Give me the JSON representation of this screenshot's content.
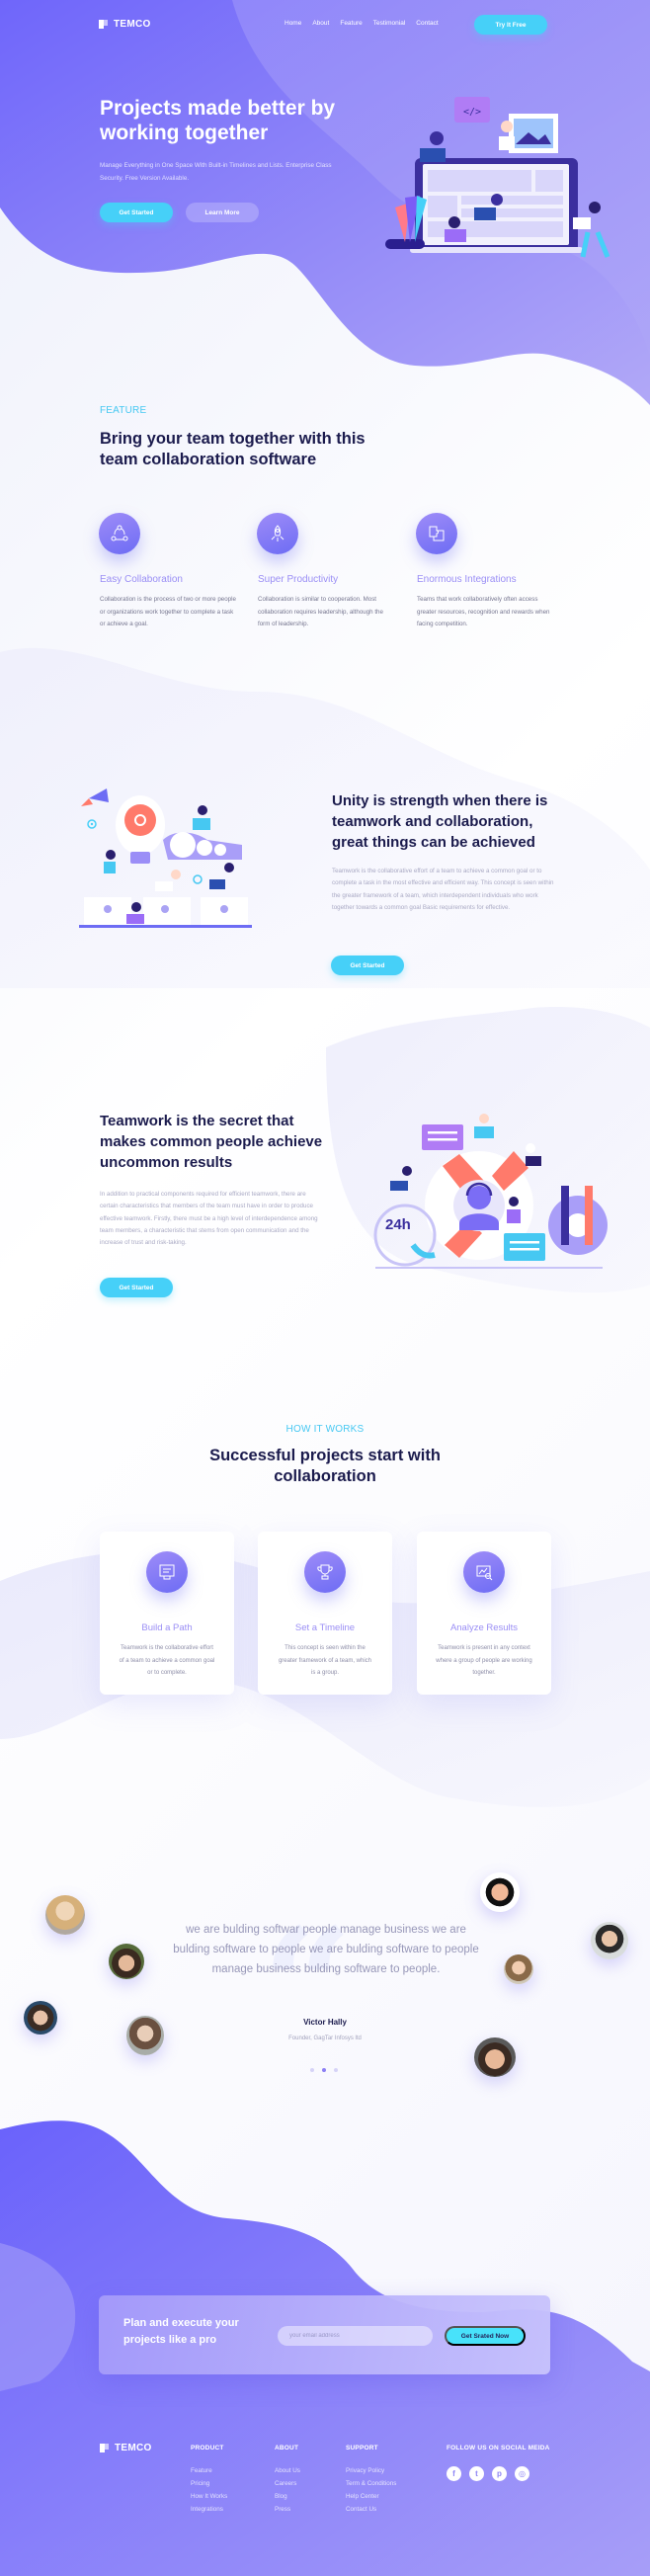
{
  "brand": {
    "name": "TEMCO",
    "accent": "#46d0f8",
    "primary": "#6c63f7"
  },
  "nav": {
    "links": [
      "Home",
      "About",
      "Feature",
      "Testimonial",
      "Contact"
    ],
    "cta_label": "Try It Free"
  },
  "hero": {
    "title": "Projects made better by working together",
    "subtitle": "Manage Everything in One Space With Built-in Timelines and Lists. Enterprise Class Security. Free Version Available.",
    "primary_button": "Get Started",
    "secondary_button": "Learn More",
    "illustration": "team-working-on-laptop-illustration"
  },
  "features": {
    "eyebrow": "FEATURE",
    "title": "Bring your team together with this team collaboration software",
    "items": [
      {
        "icon": "collaboration-icon",
        "title": "Easy Collaboration",
        "text": "Collaboration is the process of two or more people or organizations work together to complete a task or achieve a goal."
      },
      {
        "icon": "rocket-icon",
        "title": "Super Productivity",
        "text": "Collaboration is similar to cooperation. Most collaboration requires leadership, although the form of leadership."
      },
      {
        "icon": "puzzle-icon",
        "title": "Enormous Integrations",
        "text": "Teams that work collaboratively often access greater resources, recognition and rewards when facing competition."
      }
    ]
  },
  "unity": {
    "title": "Unity is strength when there is teamwork and collaboration, great things can be achieved",
    "text": "Teamwork is the collaborative effort of a team to achieve a common goal or to complete a task in the most effective and efficient way. This concept is seen within the greater framework of a team, which interdependent individuals who work together towards a common goal Basic requirements for effective.",
    "button": "Get Started",
    "illustration": "idea-bulb-team-illustration"
  },
  "teamwork": {
    "title": "Teamwork is the secret that makes common people achieve uncommon results",
    "text": "In addition to practical components required for efficient teamwork, there are certain characteristics that members of the team must have in order to produce effective teamwork. Firstly, there must be a high level of interdependence among team members, a characteristic that stems from open communication and the increase of trust and risk-taking.",
    "button": "Get Started",
    "illustration": "24h-support-team-illustration",
    "badge_24h": "24h"
  },
  "how_it_works": {
    "eyebrow": "HOW IT WORKS",
    "title": "Successful projects start with collaboration",
    "cards": [
      {
        "icon": "path-board-icon",
        "title": "Build a Path",
        "text": "Teamwork is the collaborative effort of a team to achieve a common goal or to complete."
      },
      {
        "icon": "trophy-icon",
        "title": "Set a Timeline",
        "text": "This concept is seen within the greater framework of a team, which is a group."
      },
      {
        "icon": "analytics-icon",
        "title": "Analyze Results",
        "text": "Teamwork is present in any context where a group of people are working together."
      }
    ]
  },
  "testimonial": {
    "quote": "we are bulding softwar people manage business we are bulding software to people we are bulding software to people manage business bulding software to people.",
    "name": "Victor Hally",
    "role": "Founder, GagTar Infosys ltd",
    "slides": 3,
    "active_slide": 2
  },
  "cta": {
    "title": "Plan and execute your projects like a pro",
    "email_placeholder": "your email address",
    "button": "Get Srated Now"
  },
  "footer": {
    "columns": [
      {
        "title": "PRODUCT",
        "links": [
          "Feature",
          "Pricing",
          "How It Works",
          "Integrations"
        ]
      },
      {
        "title": "ABOUT",
        "links": [
          "About Us",
          "Careers",
          "Blog",
          "Press"
        ]
      },
      {
        "title": "SUPPORT",
        "links": [
          "Privacy Policy",
          "Term & Conditions",
          "Help Center",
          "Contact Us"
        ]
      }
    ],
    "social_title": "FOLLOW US ON SOCIAL MEIDA",
    "social": [
      {
        "icon": "facebook-icon",
        "glyph": "f"
      },
      {
        "icon": "twitter-icon",
        "glyph": "t"
      },
      {
        "icon": "pinterest-icon",
        "glyph": "p"
      },
      {
        "icon": "instagram-icon",
        "glyph": "◎"
      }
    ]
  }
}
